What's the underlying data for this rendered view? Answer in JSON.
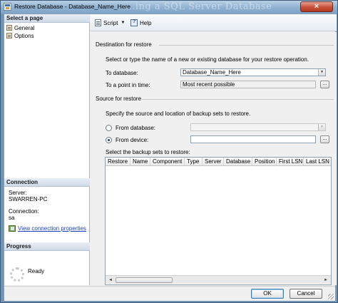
{
  "window": {
    "title": "Restore Database - Database_Name_Here",
    "watermark": "...ing a SQL Server Database",
    "close_glyph": "×"
  },
  "left_pane": {
    "select_page_header": "Select a page",
    "pages": [
      "General",
      "Options"
    ],
    "connection_header": "Connection",
    "server_label": "Server:",
    "server_value": "SWARREN-PC",
    "connection_label": "Connection:",
    "connection_value": "sa",
    "view_connection_link": "View connection properties",
    "progress_header": "Progress",
    "progress_status": "Ready"
  },
  "toolbar": {
    "script_label": "Script",
    "script_arrow": "▼",
    "help_label": "Help"
  },
  "destination": {
    "section_label": "Destination for restore",
    "description": "Select or type the name of a new or existing database for your restore operation.",
    "to_database_label": "To database:",
    "to_database_value": "Database_Name_Here",
    "point_in_time_label": "To a point in time:",
    "point_in_time_value": "Most recent possible",
    "browse_glyph": "..."
  },
  "source": {
    "section_label": "Source for restore",
    "description": "Specify the source and location of backup sets to restore.",
    "from_database_label": "From database:",
    "from_device_label": "From device:",
    "selected_option": "From device",
    "browse_glyph": "...",
    "combo_arrow": "▼"
  },
  "backup_sets": {
    "label": "Select the backup sets to restore:",
    "columns": [
      "Restore",
      "Name",
      "Component",
      "Type",
      "Server",
      "Database",
      "Position",
      "First LSN",
      "Last LSN"
    ],
    "rows": [],
    "scroll_left": "◄",
    "scroll_right": "►"
  },
  "footer": {
    "ok_label": "OK",
    "cancel_label": "Cancel"
  },
  "colors": {
    "window_frame": "#6f94b6",
    "link": "#1f3fbf",
    "dialog_background": "#f0f0f0"
  }
}
